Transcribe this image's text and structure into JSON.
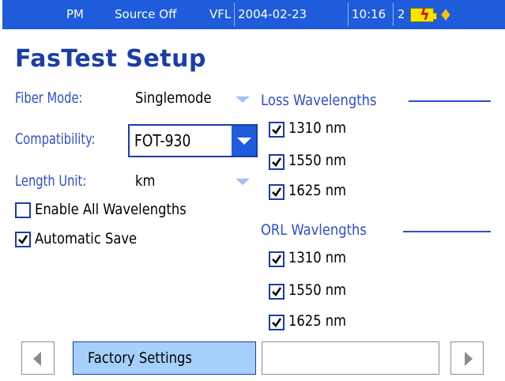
{
  "status_bar": {
    "mode": "PM",
    "source": "Source Off",
    "vfl": "VFL",
    "date": "2004-02-23",
    "time": "10:16",
    "count": "2",
    "battery_icon": "battery-charging-icon",
    "power_icon": "ac-plug-icon"
  },
  "title": "FasTest Setup",
  "fields": {
    "fiber_mode_label": "Fiber Mode:",
    "fiber_mode_value": "Singlemode",
    "compatibility_label": "Compatibility:",
    "compatibility_value": "FOT-930",
    "length_unit_label": "Length Unit:",
    "length_unit_value": "km"
  },
  "options": {
    "enable_all_label": "Enable All Wavelengths",
    "enable_all_checked": false,
    "automatic_save_label": "Automatic Save",
    "automatic_save_checked": true
  },
  "loss": {
    "title": "Loss Wavelengths",
    "items": [
      {
        "label": "1310 nm",
        "checked": true
      },
      {
        "label": "1550 nm",
        "checked": true
      },
      {
        "label": "1625 nm",
        "checked": true
      }
    ]
  },
  "orl": {
    "title": "ORL Wavlengths",
    "items": [
      {
        "label": "1310 nm",
        "checked": true
      },
      {
        "label": "1550 nm",
        "checked": true
      },
      {
        "label": "1625 nm",
        "checked": true
      }
    ]
  },
  "bottom": {
    "factory_label": "Factory Settings",
    "empty_label": ""
  },
  "colors": {
    "status_bg": "#1e5cdc",
    "accent": "#2d4fc9",
    "button_bg": "#a6d0fb"
  }
}
